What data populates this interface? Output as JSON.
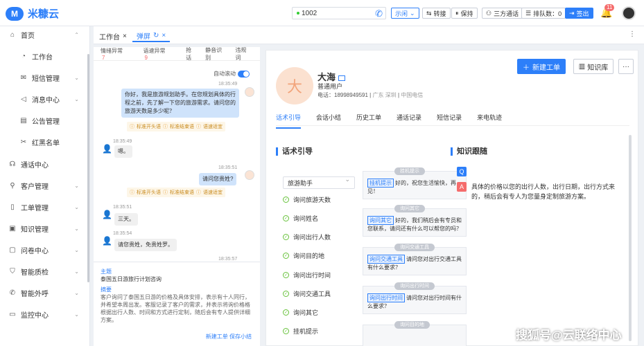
{
  "app": {
    "name": "米糠云",
    "logo_mark": "M"
  },
  "header": {
    "phone": "1002",
    "status": "示闲",
    "buttons": [
      "转接",
      "保持",
      "三方通话",
      "挂断",
      "签出"
    ],
    "queue_label": "排队数：0",
    "bell_count": "11"
  },
  "sidebar": {
    "items": [
      {
        "label": "首页",
        "icon": "home-icon",
        "expanded": true
      },
      {
        "label": "工作台",
        "icon": "dashboard-icon",
        "sub": true
      },
      {
        "label": "短信管理",
        "icon": "mail-icon",
        "sub": true
      },
      {
        "label": "消息中心",
        "icon": "speaker-icon",
        "sub": true
      },
      {
        "label": "公告管理",
        "icon": "notice-icon",
        "sub": true
      },
      {
        "label": "红黑名单",
        "icon": "list-icon",
        "sub": true
      },
      {
        "label": "通话中心",
        "icon": "headset-icon"
      },
      {
        "label": "客户管理",
        "icon": "user-icon"
      },
      {
        "label": "工单管理",
        "icon": "ticket-icon"
      },
      {
        "label": "知识管理",
        "icon": "book-icon"
      },
      {
        "label": "问卷中心",
        "icon": "survey-icon"
      },
      {
        "label": "智能质检",
        "icon": "shield-icon"
      },
      {
        "label": "智能外呼",
        "icon": "phone-out-icon"
      },
      {
        "label": "监控中心",
        "icon": "monitor-icon"
      }
    ]
  },
  "tabs": [
    {
      "label": "工作台"
    },
    {
      "label": "弹屏"
    }
  ],
  "chat": {
    "filters": [
      {
        "label": "情绪异常",
        "count": "7"
      },
      {
        "label": "语速异常",
        "count": "9"
      },
      {
        "label": "抢话"
      },
      {
        "label": "静音识别"
      },
      {
        "label": "违规词"
      }
    ],
    "autoscroll": "自动滚动",
    "messages": [
      {
        "time": "18:35:49",
        "text": "你好，我是旅游规划助手。在您规划具体的行程之前，先了解一下您的旅游需求。请问您的旅游天数是多少呢？"
      },
      {
        "time": "18:35:49",
        "text": "嗯。"
      },
      {
        "time": "18:35:51",
        "text": "请问您贵姓?"
      },
      {
        "time": "18:35:51",
        "text": "三天。"
      },
      {
        "time": "18:35:54",
        "text": "请您贵姓，免贵姓罗。"
      },
      {
        "time": "18:35:57",
        "text": ""
      }
    ],
    "tags": [
      "标准开头语",
      "标准结束语",
      "语速适宜"
    ],
    "summary": {
      "topic_label": "主题",
      "topic": "泰国五日游旅行计划咨询",
      "abstract_label": "摘要",
      "abstract": "客户询问了泰国五日游的价格及具体安排，表示有十人同行，并希望本周出发。客服记录了客户的需求，并表示将询价格格根据出行人数、时间和方式进行定制，随后会有专人提供详细方案。",
      "link1": "新建工单",
      "link2": "保存小结"
    }
  },
  "customer": {
    "avatar": "大",
    "name": "大海",
    "type": "普通用户",
    "phone": "电话：18998949591",
    "location": "广东 深圳",
    "carrier": "中国电信"
  },
  "actions": {
    "new_ticket": "新建工单",
    "knowledge": "知识库",
    "more": "···"
  },
  "main_tabs": [
    "话术引导",
    "会话小结",
    "历史工单",
    "通话记录",
    "短信记录",
    "来电轨迹"
  ],
  "script": {
    "title": "话术引导",
    "select": "旅游助手",
    "steps": [
      "询问旅游天数",
      "询问姓名",
      "询问出行人数",
      "询问目的地",
      "询问出行时间",
      "询问交通工具",
      "询问其它",
      "挂机提示"
    ],
    "cards": [
      {
        "cap": "挂机提示",
        "chip": "挂机提示",
        "text": "好的，祝您生活愉快，再见！"
      },
      {
        "cap": "询问其它",
        "chip": "询问其它",
        "text": "好的，我们稍后会有专员和您联系，请问还有什么可以帮您的吗？"
      },
      {
        "cap": "询问交通工具",
        "chip": "询问交通工具",
        "text": "请问您对出行交通工具有什么要求？"
      },
      {
        "cap": "询问出行时间",
        "chip": "询问出行时间",
        "text": "请问您对出行时间有什么要求？"
      },
      {
        "cap": "询问目的地",
        "chip": "",
        "text": ""
      }
    ]
  },
  "knowledge": {
    "title": "知识跟随",
    "q": "Q",
    "a": "A",
    "text": "具体的价格以您的出行人数，出行日期，出行方式来的，稍后会有专人为您量身定制旅游方案。"
  },
  "watermark": "搜狐号@云联络中心"
}
